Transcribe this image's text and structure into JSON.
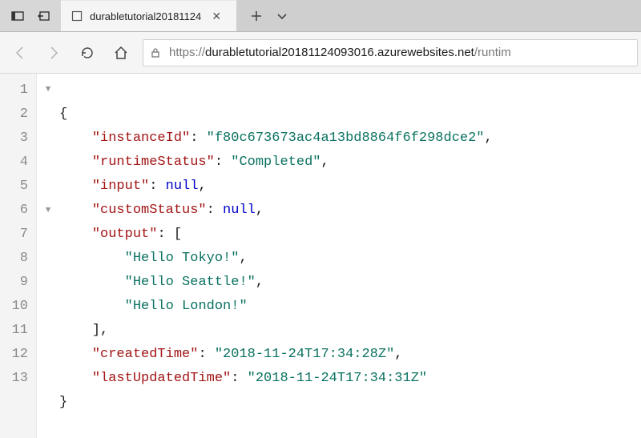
{
  "titlebar": {
    "tab_title": "durabletutorial20181124"
  },
  "toolbar": {
    "url_scheme": "https://",
    "url_host": "durabletutorial20181124093016.azurewebsites.net",
    "url_path": "/runtim"
  },
  "lines": [
    "1",
    "2",
    "3",
    "4",
    "5",
    "6",
    "7",
    "8",
    "9",
    "10",
    "11",
    "12",
    "13"
  ],
  "json": {
    "l1": "{",
    "k2": "\"instanceId\"",
    "v2": "\"f80c673673ac4a13bd8864f6f298dce2\"",
    "k3": "\"runtimeStatus\"",
    "v3": "\"Completed\"",
    "k4": "\"input\"",
    "v4": "null",
    "k5": "\"customStatus\"",
    "v5": "null",
    "k6": "\"output\"",
    "v6": "[",
    "v7": "\"Hello Tokyo!\"",
    "v8": "\"Hello Seattle!\"",
    "v9": "\"Hello London!\"",
    "v10": "]",
    "k11": "\"createdTime\"",
    "v11": "\"2018-11-24T17:34:28Z\"",
    "k12": "\"lastUpdatedTime\"",
    "v12": "\"2018-11-24T17:34:31Z\"",
    "l13": "}"
  }
}
